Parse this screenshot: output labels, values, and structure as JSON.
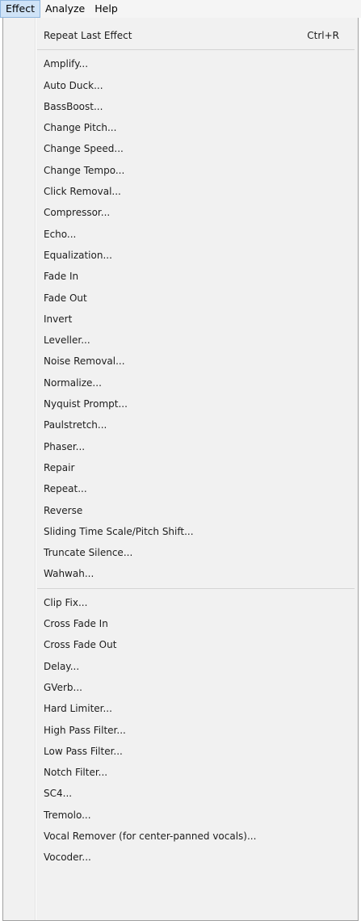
{
  "menubar": {
    "items": [
      {
        "label": "Effect"
      },
      {
        "label": "Analyze"
      },
      {
        "label": "Help"
      }
    ]
  },
  "menu": {
    "top": {
      "label": "Repeat Last Effect",
      "shortcut": "Ctrl+R"
    },
    "group1": [
      "Amplify...",
      "Auto Duck...",
      "BassBoost...",
      "Change Pitch...",
      "Change Speed...",
      "Change Tempo...",
      "Click Removal...",
      "Compressor...",
      "Echo...",
      "Equalization...",
      "Fade In",
      "Fade Out",
      "Invert",
      "Leveller...",
      "Noise Removal...",
      "Normalize...",
      "Nyquist Prompt...",
      "Paulstretch...",
      "Phaser...",
      "Repair",
      "Repeat...",
      "Reverse",
      "Sliding Time Scale/Pitch Shift...",
      "Truncate Silence...",
      "Wahwah..."
    ],
    "group2": [
      "Clip Fix...",
      "Cross Fade In",
      "Cross Fade Out",
      "Delay...",
      "GVerb...",
      "Hard Limiter...",
      "High Pass Filter...",
      "Low Pass Filter...",
      "Notch Filter...",
      "SC4...",
      "Tremolo...",
      "Vocal Remover (for center-panned vocals)...",
      "Vocoder..."
    ]
  }
}
